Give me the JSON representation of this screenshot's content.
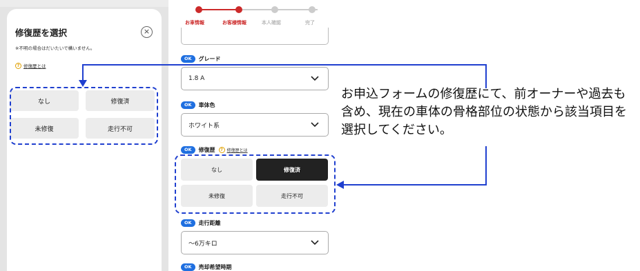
{
  "modal": {
    "title": "修復歴を選択",
    "close_icon": "×",
    "note": "※不明の場合はだいたいで構いません。",
    "help_icon": "?",
    "help_link": "修復歴とは",
    "options": [
      "なし",
      "修復済",
      "未修復",
      "走行不可"
    ]
  },
  "progress": {
    "steps": [
      "お車情報",
      "お客様情報",
      "本人確認",
      "完了"
    ],
    "active_color": "#cc2a2a",
    "inactive_color": "#cccccc"
  },
  "form": {
    "grade": {
      "badge": "OK",
      "label": "グレード",
      "value": "1.8 A"
    },
    "color": {
      "badge": "OK",
      "label": "車体色",
      "value": "ホワイト系"
    },
    "repair": {
      "badge": "OK",
      "label": "修復歴",
      "help_icon": "?",
      "help_link": "修復歴とは",
      "options": [
        "なし",
        "修復済",
        "未修復",
        "走行不可"
      ],
      "selected": "修復済"
    },
    "mileage": {
      "badge": "OK",
      "label": "走行距離",
      "value": "〜6万キロ"
    },
    "sale_timing": {
      "badge": "OK",
      "label": "売却希望時期"
    }
  },
  "annotation": {
    "text": "お申込フォームの修復歴にて、前オーナーや過去も含め、現在の車体の骨格部位の状態から該当項目を選択してください。"
  },
  "colors": {
    "accent_blue": "#1f3fcf",
    "badge_blue": "#1f6fe0",
    "selected_dark": "#222222"
  }
}
